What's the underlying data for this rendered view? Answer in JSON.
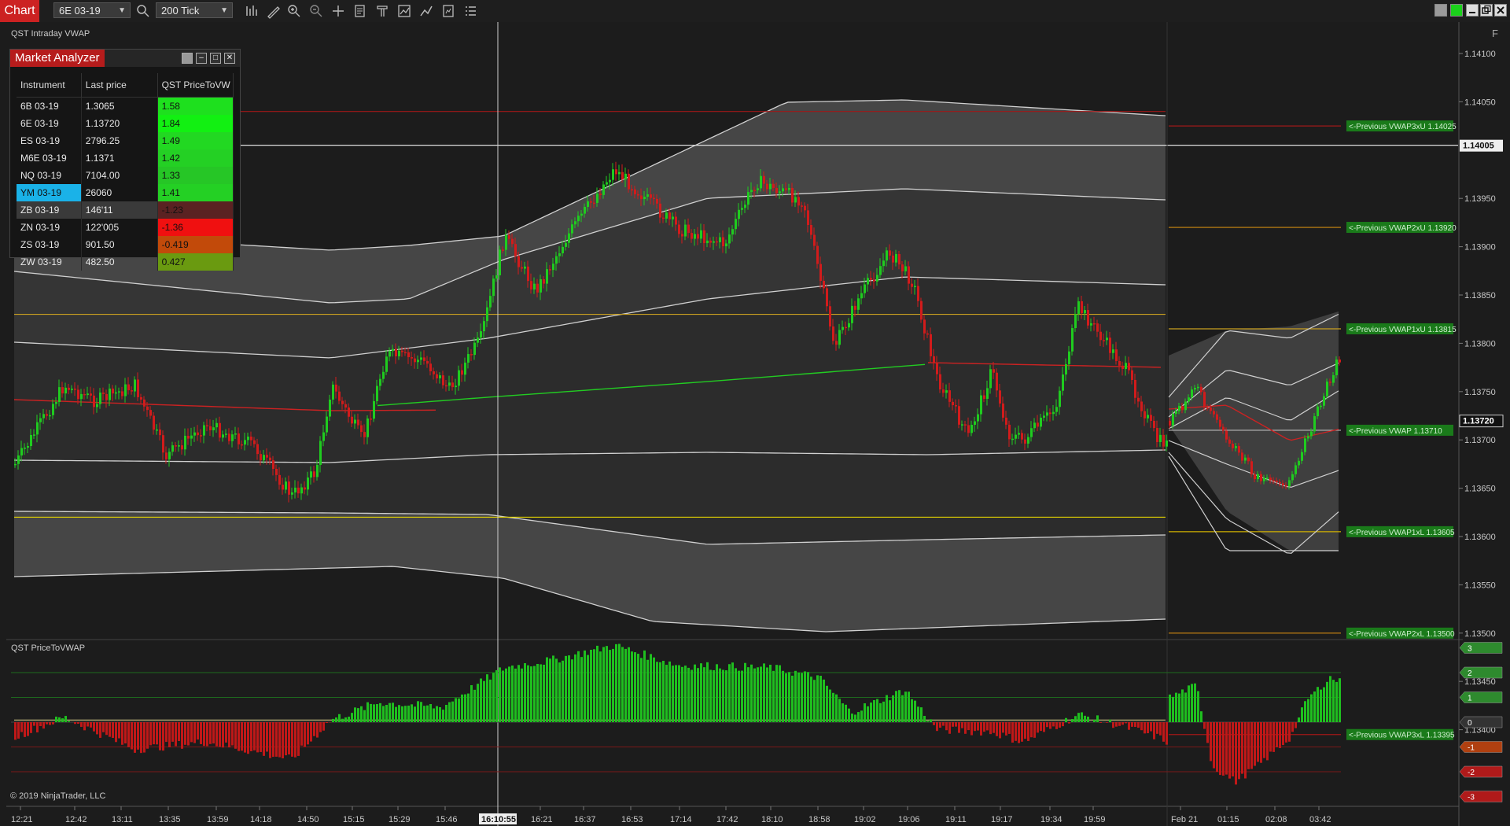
{
  "toolbar": {
    "chart_tab": "Chart",
    "instrument": "6E 03-19",
    "interval": "200 Tick",
    "icons": [
      "search-icon",
      "bar-style-icon",
      "draw-tool-icon",
      "zoom-in-icon",
      "zoom-out-icon",
      "crosshair-icon",
      "templates-icon",
      "strategies-icon",
      "indicators-icon",
      "chart-trader-icon",
      "properties-icon",
      "data-box-icon"
    ]
  },
  "window_controls": [
    "restore-icon",
    "link-color-icon",
    "minimize-icon",
    "maximize-icon",
    "close-icon"
  ],
  "chart_title": "QST Intraday VWAP",
  "f_label": "F",
  "market_analyzer": {
    "title": "Market Analyzer",
    "columns": [
      "Instrument",
      "Last price",
      "QST PriceToVW"
    ],
    "rows": [
      {
        "instrument": "6B 03-19",
        "last": "1.3065",
        "value": "1.58",
        "color": "#1ee01e"
      },
      {
        "instrument": "6E 03-19",
        "last": "1.13720",
        "value": "1.84",
        "color": "#12f012"
      },
      {
        "instrument": "ES 03-19",
        "last": "2796.25",
        "value": "1.49",
        "color": "#22d822"
      },
      {
        "instrument": "M6E 03-19",
        "last": "1.1371",
        "value": "1.42",
        "color": "#24d024"
      },
      {
        "instrument": "NQ 03-19",
        "last": "7104.00",
        "value": "1.33",
        "color": "#26c626"
      },
      {
        "instrument": "YM 03-19",
        "last": "26060",
        "value": "1.41",
        "color": "#24d024",
        "selected": true
      },
      {
        "instrument": "ZB 03-19",
        "last": "146'11",
        "value": "-1.23",
        "color": "#5a2222"
      },
      {
        "instrument": "ZN 03-19",
        "last": "122'005",
        "value": "-1.36",
        "color": "#f01010"
      },
      {
        "instrument": "ZS 03-19",
        "last": "901.50",
        "value": "-0.419",
        "color": "#c24a0a"
      },
      {
        "instrument": "ZW 03-19",
        "last": "482.50",
        "value": "0.427",
        "color": "#6a9a10"
      }
    ]
  },
  "price_axis": {
    "ticks": [
      "1.14100",
      "1.14050",
      "1.14005",
      "1.13950",
      "1.13900",
      "1.13850",
      "1.13800",
      "1.13750",
      "1.13720",
      "1.13700",
      "1.13650",
      "1.13600",
      "1.13550",
      "1.13500",
      "1.13450",
      "1.13400"
    ],
    "highlight_current": "1.13720",
    "highlight_level": "1.14005"
  },
  "vwap_labels": [
    {
      "text": "<-Previous VWAP3xU 1.14025",
      "price": 1.14025
    },
    {
      "text": "<-Previous VWAP2xU 1.13920",
      "price": 1.1392
    },
    {
      "text": "<-Previous VWAP1xU 1.13815",
      "price": 1.13815
    },
    {
      "text": "<-Previous VWAP 1.13710",
      "price": 1.1371
    },
    {
      "text": "<-Previous VWAP1xL 1.13605",
      "price": 1.13605
    },
    {
      "text": "<-Previous VWAP2xL 1.13500",
      "price": 1.135
    },
    {
      "text": "<-Previous VWAP3xL 1.13395",
      "price": 1.13395
    }
  ],
  "indicator": {
    "title": "QST PriceToVWAP",
    "levels": [
      {
        "label": "3",
        "value": 3,
        "color": "#2e8a2e"
      },
      {
        "label": "2",
        "value": 2,
        "color": "#2e8a2e"
      },
      {
        "label": "1",
        "value": 1,
        "color": "#2e8a2e"
      },
      {
        "label": "0",
        "value": 0,
        "color": "#333"
      },
      {
        "label": "-1",
        "value": -1,
        "color": "#b04010"
      },
      {
        "label": "-2",
        "value": -2,
        "color": "#b01a1a"
      },
      {
        "label": "-3",
        "value": -3,
        "color": "#b01a1a"
      }
    ]
  },
  "time_axis": {
    "ticks": [
      "12:21",
      "12:42",
      "13:11",
      "13:35",
      "13:59",
      "14:18",
      "14:50",
      "15:15",
      "15:29",
      "15:46",
      "16:10:55",
      "16:21",
      "16:37",
      "16:53",
      "17:14",
      "17:42",
      "18:10",
      "18:58",
      "19:02",
      "19:06",
      "19:11",
      "19:17",
      "19:34",
      "19:59",
      "Feb 21",
      "01:15",
      "02:08",
      "03:42"
    ],
    "cursor_label": "16:10:55"
  },
  "copyright": "© 2019 NinjaTrader, LLC",
  "colors": {
    "up": "#1fcc1f",
    "down": "#d21b1b",
    "vwap": "#22cc22",
    "band_fill": "#5a5a5a"
  }
}
